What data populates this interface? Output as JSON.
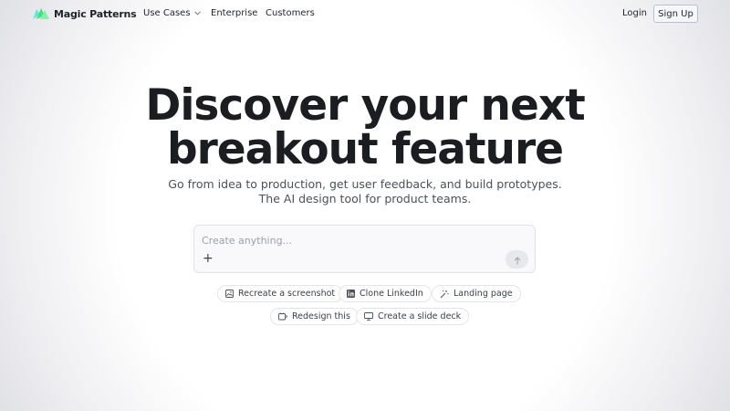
{
  "nav": {
    "brand": "Magic Patterns",
    "links": [
      {
        "label": "Use Cases",
        "has_dropdown": true
      },
      {
        "label": "Enterprise"
      },
      {
        "label": "Customers"
      }
    ],
    "login_label": "Login",
    "signup_label": "Sign Up"
  },
  "hero": {
    "headline_line1": "Discover your next",
    "headline_line2": "breakout feature",
    "subtitle_line1": "Go from idea to production, get user feedback, and build prototypes.",
    "subtitle_line2": "The AI design tool for product teams."
  },
  "prompt": {
    "placeholder": "Create anything...",
    "value": ""
  },
  "suggestions": [
    {
      "label": "Recreate a screenshot",
      "icon": "image-icon"
    },
    {
      "label": "Clone LinkedIn",
      "icon": "linkedin-icon"
    },
    {
      "label": "Landing page",
      "icon": "magic-wand-icon"
    },
    {
      "label": "Redesign this",
      "icon": "redesign-icon"
    },
    {
      "label": "Create a slide deck",
      "icon": "presentation-icon"
    }
  ],
  "colors": {
    "brand_green": "#4ade80",
    "brand_teal": "#34d399",
    "signup_border": "#b8bfd6",
    "headline": "#1b1d21"
  }
}
